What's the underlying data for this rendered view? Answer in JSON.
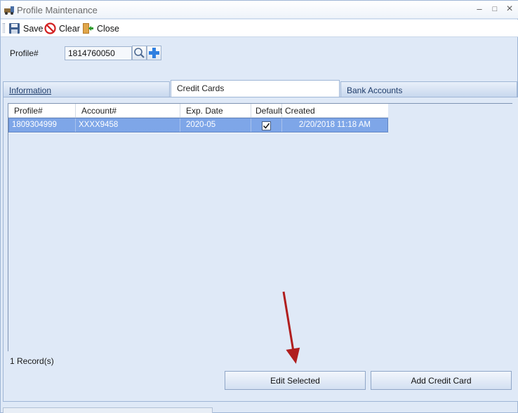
{
  "window": {
    "title": "Profile Maintenance",
    "minimize": "–",
    "maximize": "□",
    "close": "×"
  },
  "toolbar": {
    "save_label": "Save",
    "clear_label": "Clear",
    "close_label": "Close",
    "icons": {
      "save": "floppy-disk-icon",
      "clear": "no-entry-icon",
      "close": "door-exit-icon"
    }
  },
  "profile": {
    "label": "Profile#",
    "value": "1814760050"
  },
  "tabs": [
    {
      "label": "Information"
    },
    {
      "label": "Credit Cards",
      "active": true
    },
    {
      "label": "Bank Accounts"
    }
  ],
  "grid": {
    "columns": [
      "Profile#",
      "Account#",
      "Exp. Date",
      "Default",
      "Created"
    ],
    "rows": [
      {
        "profile": "1809304999",
        "account": "XXXX9458",
        "exp": "2020-05",
        "default": true,
        "created": "2/20/2018 11:18 AM"
      }
    ]
  },
  "records_label": "1 Record(s)",
  "buttons": {
    "edit": "Edit Selected",
    "add": "Add Credit Card"
  },
  "colors": {
    "selection": "#7ea6e8",
    "annotation_arrow": "#b01e1e",
    "background": "#dfe9f7"
  }
}
